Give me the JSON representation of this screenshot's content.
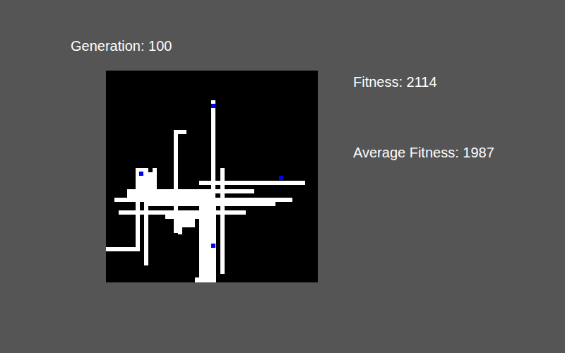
{
  "generation": {
    "text": "Generation: 100"
  },
  "stats": [
    {
      "text": "Fitness: 2114"
    },
    {
      "text": "Average Fitness: 1987"
    }
  ]
}
